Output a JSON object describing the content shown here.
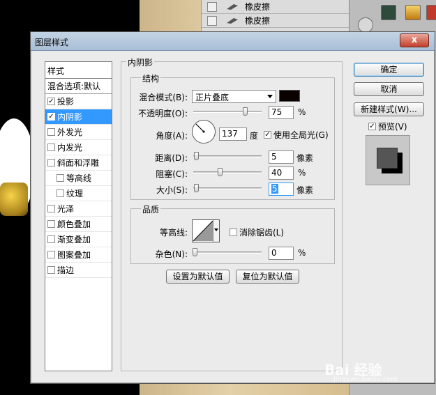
{
  "background": {
    "layers": [
      {
        "name": "橡皮擦"
      },
      {
        "name": "橡皮擦"
      }
    ]
  },
  "dialog": {
    "title": "图层样式",
    "close_label": "x"
  },
  "style_list": {
    "header": "样式",
    "blend_options": "混合选项:默认",
    "items": [
      {
        "label": "投影",
        "checked": true,
        "sub": false,
        "selected": false
      },
      {
        "label": "内阴影",
        "checked": true,
        "sub": false,
        "selected": true
      },
      {
        "label": "外发光",
        "checked": false,
        "sub": false,
        "selected": false
      },
      {
        "label": "内发光",
        "checked": false,
        "sub": false,
        "selected": false
      },
      {
        "label": "斜面和浮雕",
        "checked": false,
        "sub": false,
        "selected": false
      },
      {
        "label": "等高线",
        "checked": false,
        "sub": true,
        "selected": false
      },
      {
        "label": "纹理",
        "checked": false,
        "sub": true,
        "selected": false
      },
      {
        "label": "光泽",
        "checked": false,
        "sub": false,
        "selected": false
      },
      {
        "label": "颜色叠加",
        "checked": false,
        "sub": false,
        "selected": false
      },
      {
        "label": "渐变叠加",
        "checked": false,
        "sub": false,
        "selected": false
      },
      {
        "label": "图案叠加",
        "checked": false,
        "sub": false,
        "selected": false
      },
      {
        "label": "描边",
        "checked": false,
        "sub": false,
        "selected": false
      }
    ]
  },
  "inner_shadow": {
    "section_title": "内阴影",
    "structure_title": "结构",
    "blend_mode_label": "混合模式(B):",
    "blend_mode_value": "正片叠底",
    "shadow_color": "#0a0000",
    "opacity_label": "不透明度(O):",
    "opacity_value": "75",
    "opacity_unit": "%",
    "angle_label": "角度(A):",
    "angle_value": "137",
    "angle_unit": "度",
    "global_light_label": "使用全局光(G)",
    "global_light_checked": true,
    "distance_label": "距离(D):",
    "distance_value": "5",
    "distance_unit": "像素",
    "choke_label": "阻塞(C):",
    "choke_value": "40",
    "choke_unit": "%",
    "size_label": "大小(S):",
    "size_value": "5",
    "size_unit": "像素",
    "quality_title": "品质",
    "contour_label": "等高线:",
    "antialias_label": "消除锯齿(L)",
    "antialias_checked": false,
    "noise_label": "杂色(N):",
    "noise_value": "0",
    "noise_unit": "%",
    "make_default_label": "设置为默认值",
    "reset_default_label": "复位为默认值"
  },
  "actions": {
    "ok_label": "确定",
    "cancel_label": "取消",
    "new_style_label": "新建样式(W)...",
    "preview_label": "预览(V)",
    "preview_checked": true
  },
  "watermark": {
    "brand": "Bai 经验",
    "url": "jingyan.baidu.com"
  }
}
